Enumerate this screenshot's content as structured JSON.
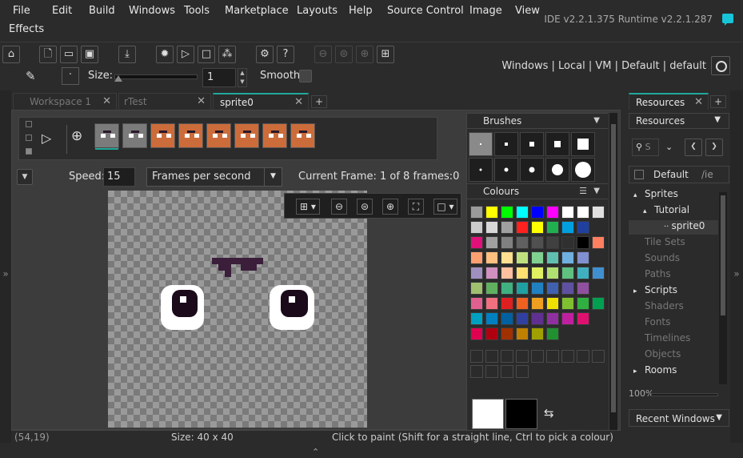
{
  "menu": {
    "items": [
      "File",
      "Edit",
      "Build",
      "Windows",
      "Tools",
      "Marketplace",
      "Layouts",
      "Help",
      "Source Control",
      "Image",
      "View"
    ],
    "second_row": [
      "Effects"
    ],
    "version": "IDE v2.2.1.375  Runtime v2.2.1.287"
  },
  "toolbar": {
    "target_links": "Windows  |  Local  |  VM  |  Default  |  default",
    "size_label": "Size:",
    "size_value": "1",
    "smooth_label": "Smooth"
  },
  "tabs": [
    {
      "label": "Workspace 1",
      "active": false
    },
    {
      "label": "rTest",
      "active": false
    },
    {
      "label": "sprite0",
      "active": true
    }
  ],
  "editor": {
    "speed_label": "Speed:",
    "speed_value": "15",
    "speed_unit": "Frames per second",
    "current_frame": "Current Frame: 1 of 8 frames:0",
    "frame_count": 8,
    "frame_types": [
      "ghost",
      "ghost",
      "orange",
      "orange",
      "orange",
      "orange",
      "orange",
      "orange"
    ]
  },
  "brushes": {
    "title": "Brushes"
  },
  "colours": {
    "title": "Colours",
    "rows": [
      [
        "#9a9a9a",
        "#ffff00",
        "#00ff00",
        "#00ffff",
        "#0000ff",
        "#ff00ff",
        "#ffffff",
        "#ffffff",
        "#e0e0e0"
      ],
      [
        "#cccccc",
        "#d8d8d8",
        "#a0a0a0",
        "#ff2020",
        "#ffff00",
        "#20b050",
        "#00a0e0",
        "#2040a0"
      ],
      [
        "#e0107a",
        "#a0a0a0",
        "#808080",
        "#606060",
        "#505050",
        "#404040",
        "#303030",
        "#000000",
        "#ff8060"
      ],
      [
        "#ffa070",
        "#ffc080",
        "#ffe090",
        "#c0e080",
        "#80d090",
        "#60c0b0",
        "#70b0e0",
        "#8090d0"
      ],
      [
        "#a090c0",
        "#d090c0",
        "#ffc0a0",
        "#ffe070",
        "#e0f060",
        "#b0e070",
        "#60c080",
        "#40b0c0",
        "#4090d0"
      ],
      [
        "#a0c070",
        "#60b060",
        "#40b080",
        "#20a0a0",
        "#2080c0",
        "#4060b0",
        "#6050a0",
        "#9050a0"
      ],
      [
        "#e06090",
        "#f07080",
        "#e02020",
        "#f06020",
        "#f0a020",
        "#f0e000",
        "#80c030",
        "#30b040",
        "#00a050"
      ],
      [
        "#00a0c0",
        "#0080c0",
        "#0060a0",
        "#3040a0",
        "#603090",
        "#9030a0",
        "#c020a0",
        "#e01070"
      ],
      [
        "#e00050",
        "#b00010",
        "#a03000",
        "#c08000",
        "#a0a000",
        "#209030"
      ]
    ],
    "primary": "#ffffff",
    "secondary": "#000000"
  },
  "status": {
    "coords": "(54,19)",
    "size": "Size: 40 x 40",
    "hint": "Click to paint (Shift for a straight line, Ctrl to pick a colour)"
  },
  "resources": {
    "tab_label": "Resources",
    "header": "Resources",
    "search_placeholder": "S",
    "filter_label": "Default",
    "filter_suffix": "/ie",
    "tree": [
      {
        "label": "Sprites",
        "indent": 0,
        "arrow": "▴",
        "dim": false
      },
      {
        "label": "Tutorial",
        "indent": 1,
        "arrow": "▴",
        "dim": false
      },
      {
        "label": "sprite0",
        "indent": 2,
        "arrow": "",
        "dim": false,
        "selected": true
      },
      {
        "label": "Tile Sets",
        "indent": 0,
        "arrow": "",
        "dim": true
      },
      {
        "label": "Sounds",
        "indent": 0,
        "arrow": "",
        "dim": true
      },
      {
        "label": "Paths",
        "indent": 0,
        "arrow": "",
        "dim": true
      },
      {
        "label": "Scripts",
        "indent": 0,
        "arrow": "▸",
        "dim": false
      },
      {
        "label": "Shaders",
        "indent": 0,
        "arrow": "",
        "dim": true
      },
      {
        "label": "Fonts",
        "indent": 0,
        "arrow": "",
        "dim": true
      },
      {
        "label": "Timelines",
        "indent": 0,
        "arrow": "",
        "dim": true
      },
      {
        "label": "Objects",
        "indent": 0,
        "arrow": "",
        "dim": true
      },
      {
        "label": "Rooms",
        "indent": 0,
        "arrow": "▸",
        "dim": false
      }
    ],
    "zoom": "100%",
    "recent_windows": "Recent Windows"
  }
}
